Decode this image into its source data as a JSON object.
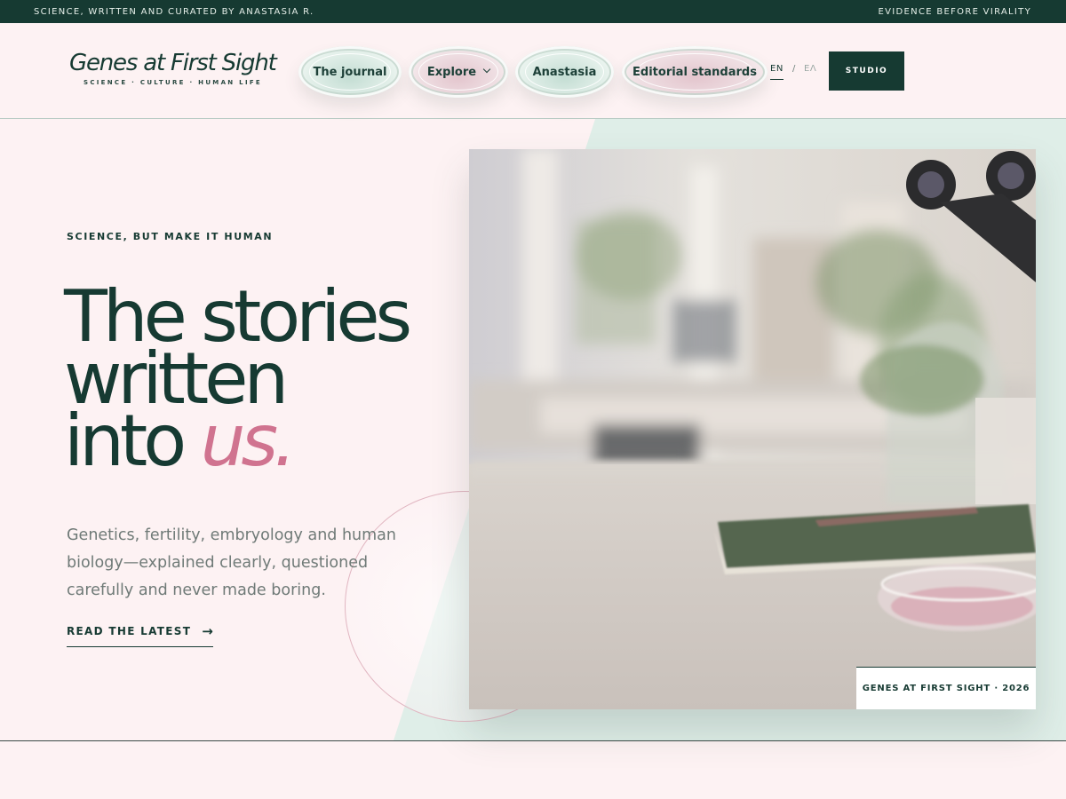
{
  "topbar": {
    "left_text": "SCIENCE, WRITTEN AND CURATED BY ANASTASIA R.",
    "right_text": "EVIDENCE BEFORE VIRALITY"
  },
  "logo": {
    "title": "Genes at First Sight",
    "tagline": "SCIENCE · CULTURE · HUMAN LIFE"
  },
  "nav": {
    "items": [
      {
        "label": "The journal",
        "style": "green"
      },
      {
        "label": "Explore",
        "style": "pink",
        "has_dropdown": true
      },
      {
        "label": "Anastasia",
        "style": "green"
      },
      {
        "label": "Editorial standards",
        "style": "pink"
      }
    ],
    "language": {
      "active": "EN",
      "separator": "/",
      "other": "ΕΛ"
    },
    "studio_label": "STUDIO"
  },
  "hero": {
    "eyebrow": "SCIENCE, BUT MAKE IT HUMAN",
    "headline_line1": "The stories",
    "headline_line2": "written",
    "headline_line3_plain": "into",
    "headline_line3_accent": "us.",
    "lede": "Genetics, fertility, embryology and human biology—explained clearly, questioned carefully and never made boring.",
    "cta_label": "READ THE LATEST",
    "photo_caption": "GENES AT FIRST SIGHT · 2026"
  },
  "colors": {
    "brand_dark": "#163a32",
    "accent_pink": "#d0738f",
    "page_background": "#fdf2f3",
    "mint_panel": "#dfeee8"
  },
  "icons": {
    "explore_dropdown": "chevron-down-icon",
    "cta_arrow": "arrow-right-icon"
  }
}
